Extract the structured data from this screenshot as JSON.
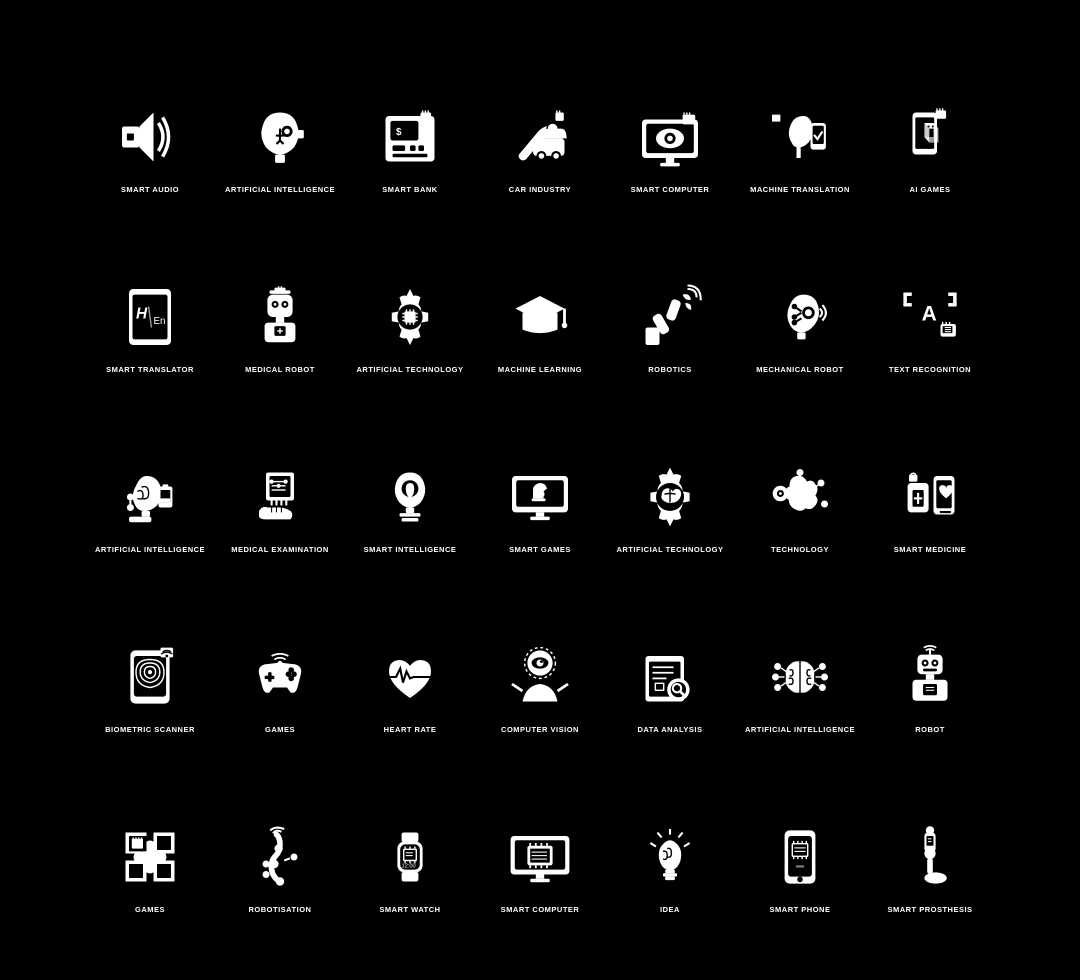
{
  "icons": [
    {
      "id": "smart-audio",
      "label": "SMART AUDIO"
    },
    {
      "id": "artificial-intelligence-1",
      "label": "ARTIFICIAL INTELLIGENCE"
    },
    {
      "id": "smart-bank",
      "label": "SMART BANK"
    },
    {
      "id": "car-industry",
      "label": "CAR INDUSTRY"
    },
    {
      "id": "smart-computer-1",
      "label": "SMART COMPUTER"
    },
    {
      "id": "machine-translation",
      "label": "MACHINE TRANSLATION"
    },
    {
      "id": "ai-games",
      "label": "AI GAMES"
    },
    {
      "id": "smart-translator",
      "label": "SMART TRANSLATOR"
    },
    {
      "id": "medical-robot",
      "label": "MEDICAL ROBOT"
    },
    {
      "id": "artificial-technology-1",
      "label": "ARTIFICIAL TECHNOLOGY"
    },
    {
      "id": "machine-learning",
      "label": "MACHINE LEARNING"
    },
    {
      "id": "robotics",
      "label": "ROBOTICS"
    },
    {
      "id": "mechanical-robot",
      "label": "MECHANICAL ROBOT"
    },
    {
      "id": "text-recognition",
      "label": "TEXT RECOGNITION"
    },
    {
      "id": "artificial-intelligence-2",
      "label": "ARTIFICIAL INTELLIGENCE"
    },
    {
      "id": "medical-examination",
      "label": "MEDICAL EXAMINATION"
    },
    {
      "id": "smart-intelligence",
      "label": "SMART INTELLIGENCE"
    },
    {
      "id": "smart-games",
      "label": "SMART GAMES"
    },
    {
      "id": "artificial-technology-2",
      "label": "ARTIFICIAL TECHNOLOGY"
    },
    {
      "id": "technology",
      "label": "TECHNOLOGY"
    },
    {
      "id": "smart-medicine",
      "label": "SMART MEDICINE"
    },
    {
      "id": "biometric-scanner",
      "label": "BIOMETRIC SCANNER"
    },
    {
      "id": "games-1",
      "label": "GAMES"
    },
    {
      "id": "heart-rate",
      "label": "HEART RATE"
    },
    {
      "id": "computer-vision",
      "label": "COMPUTER VISION"
    },
    {
      "id": "data-analysis",
      "label": "DATA ANALYSIS"
    },
    {
      "id": "artificial-intelligence-3",
      "label": "ARTIFICIAL INTELLIGENCE"
    },
    {
      "id": "robot",
      "label": "ROBOT"
    },
    {
      "id": "games-2",
      "label": "GAMES"
    },
    {
      "id": "robotisation",
      "label": "ROBOTISATION"
    },
    {
      "id": "smart-watch",
      "label": "SMART WATCH"
    },
    {
      "id": "smart-computer-2",
      "label": "SMART COMPUTER"
    },
    {
      "id": "idea",
      "label": "IDEA"
    },
    {
      "id": "smart-phone",
      "label": "SMART PHONE"
    },
    {
      "id": "smart-prosthesis",
      "label": "SMART PROSTHESIS"
    }
  ]
}
